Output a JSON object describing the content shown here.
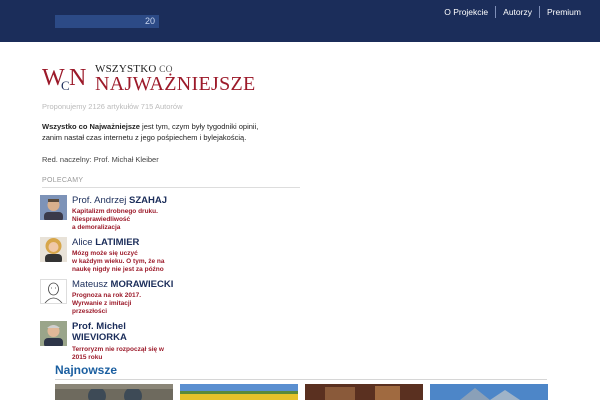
{
  "header": {
    "search_count": "20",
    "nav": [
      {
        "label": "O Projekcie"
      },
      {
        "label": "Autorzy"
      },
      {
        "label": "Premium"
      }
    ]
  },
  "logo": {
    "mark_letters": [
      "W",
      "C",
      "N"
    ],
    "line1_main": "WSZYSTKO",
    "line1_small": " CO",
    "line2": "NAJWAŻNIEJSZE"
  },
  "stats": "Proponujemy 2126 artykułów 715 Autorów",
  "intro": {
    "bold": "Wszystko co Najważniejsze",
    "line1_rest": " jest tym, czym były tygodniki opinii,",
    "line2": "zanim nastał czas internetu z jego pośpiechem i bylejakością."
  },
  "editor": "Red. naczelny: Prof. Michał Kleiber",
  "recommended": {
    "label": "POLECAMY",
    "items": [
      {
        "name_plain": "Prof. Andrzej ",
        "name_bold": "SZAHAJ",
        "title_lines": [
          "Kapitalizm drobnego druku.",
          "Niesprawiedliwość",
          "a demoralizacja"
        ]
      },
      {
        "name_plain": "Alice ",
        "name_bold": "LATIMIER",
        "title_lines": [
          "Mózg może się uczyć",
          "w każdym wieku. O tym, że na",
          "naukę nigdy nie jest za późno"
        ]
      },
      {
        "name_plain": "Mateusz ",
        "name_bold": "MORAWIECKI",
        "title_lines": [
          "Prognoza na rok 2017.",
          "Wyrwanie z imitacji",
          "przeszłości"
        ]
      },
      {
        "name_plain": "Prof. Michel",
        "name_bold": "WIEVIORKA",
        "title_lines": [
          "Terroryzm nie rozpoczął się w",
          "2015 roku"
        ]
      }
    ]
  },
  "latest": {
    "heading": "Najnowsze"
  },
  "colors": {
    "header_bg": "#1b2d5a",
    "brand_red": "#9c1a2a",
    "accent_blue": "#1b5fa0"
  }
}
